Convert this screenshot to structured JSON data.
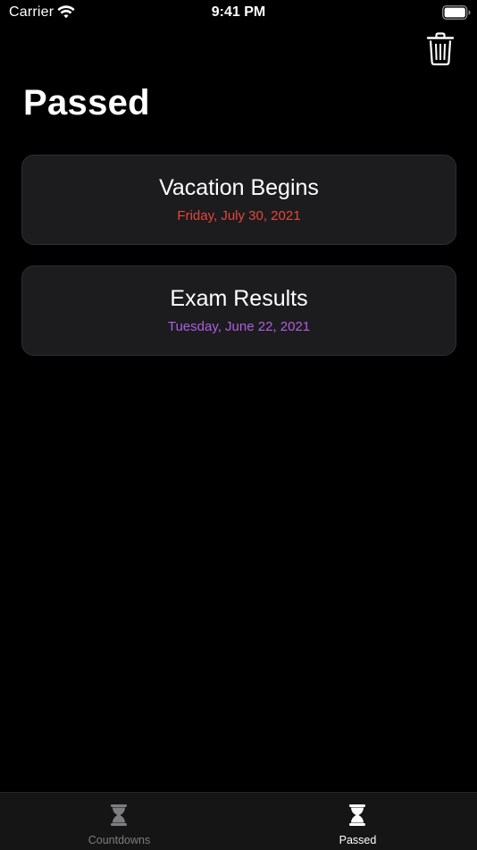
{
  "status_bar": {
    "carrier": "Carrier",
    "time": "9:41 PM"
  },
  "header": {
    "title": "Passed",
    "delete_icon": "trash-icon"
  },
  "events": [
    {
      "title": "Vacation Begins",
      "date": "Friday, July 30, 2021",
      "date_color": "#e5463c"
    },
    {
      "title": "Exam Results",
      "date": "Tuesday, June 22, 2021",
      "date_color": "#b05ee0"
    }
  ],
  "tab_bar": {
    "tabs": [
      {
        "label": "Countdowns",
        "icon": "hourglass-icon",
        "selected": false,
        "color": "#7d7d80"
      },
      {
        "label": "Passed",
        "icon": "hourglass-icon",
        "selected": true,
        "color": "#ffffff"
      }
    ]
  },
  "colors": {
    "background": "#000000",
    "card": "#1c1c1e",
    "text": "#ffffff",
    "inactive_tab": "#7d7d80"
  }
}
